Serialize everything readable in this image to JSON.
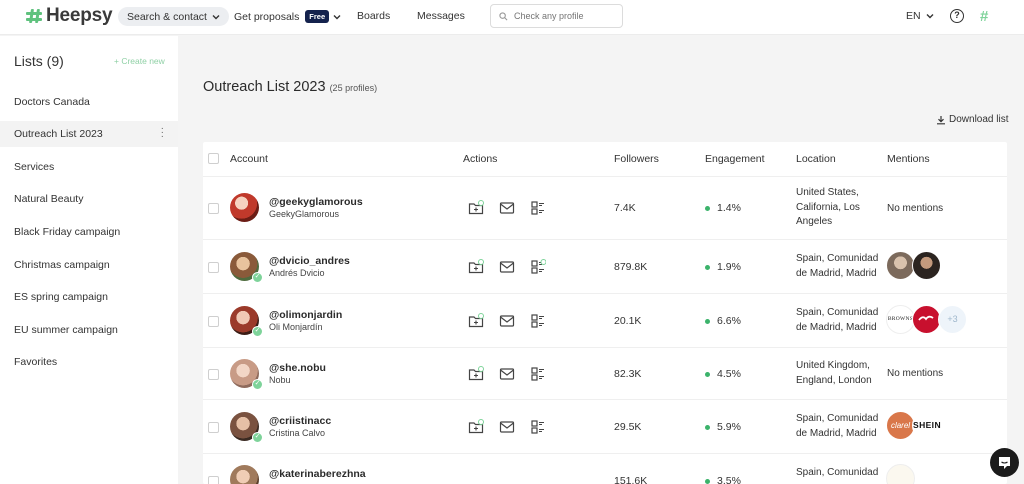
{
  "brand": {
    "name": "Heepsy",
    "accent": "#5fc27e"
  },
  "nav": {
    "search_contact": "Search & contact",
    "get_proposals": "Get proposals",
    "free_badge": "Free",
    "boards": "Boards",
    "messages": "Messages",
    "search_placeholder": "Check any profile",
    "language": "EN"
  },
  "sidebar": {
    "title": "Lists (9)",
    "create_new": "+ Create new",
    "items": [
      {
        "label": "Doctors Canada"
      },
      {
        "label": "Outreach List 2023"
      },
      {
        "label": "Services"
      },
      {
        "label": "Natural Beauty"
      },
      {
        "label": "Black Friday campaign"
      },
      {
        "label": "Christmas campaign"
      },
      {
        "label": "ES spring campaign"
      },
      {
        "label": "EU summer campaign"
      },
      {
        "label": "Favorites"
      }
    ]
  },
  "main": {
    "title": "Outreach List 2023",
    "count": "(25 profiles)",
    "download": "Download list"
  },
  "table": {
    "headers": {
      "account": "Account",
      "actions": "Actions",
      "followers": "Followers",
      "engagement": "Engagement",
      "location": "Location",
      "mentions": "Mentions"
    },
    "rows": [
      {
        "handle": "@geekyglamorous",
        "name": "GeekyGlamorous",
        "followers": "7.4K",
        "engagement": "1.4%",
        "location": "United States, California, Los Angeles",
        "mentions": "No mentions"
      },
      {
        "handle": "@dvicio_andres",
        "name": "Andrés Dvicio",
        "followers": "879.8K",
        "engagement": "1.9%",
        "location": "Spain, Comunidad de Madrid, Madrid",
        "mentions": ""
      },
      {
        "handle": "@olimonjardin",
        "name": "Oli Monjardín",
        "followers": "20.1K",
        "engagement": "6.6%",
        "location": "Spain, Comunidad de Madrid, Madrid",
        "mentions": "",
        "mention_brand": "BROWNS",
        "more": "+3"
      },
      {
        "handle": "@she.nobu",
        "name": "Nobu",
        "followers": "82.3K",
        "engagement": "4.5%",
        "location": "United Kingdom, England, London",
        "mentions": "No mentions"
      },
      {
        "handle": "@criistinacc",
        "name": "Cristina Calvo",
        "followers": "29.5K",
        "engagement": "5.9%",
        "location": "Spain, Comunidad de Madrid, Madrid",
        "mentions": "",
        "mention_brand_1": "clarel",
        "mention_brand_2": "SHEIN"
      },
      {
        "handle": "@katerinaberezhna",
        "name": "",
        "followers": "151.6K",
        "engagement": "3.5%",
        "location": "Spain, Comunidad",
        "mentions": ""
      }
    ]
  }
}
